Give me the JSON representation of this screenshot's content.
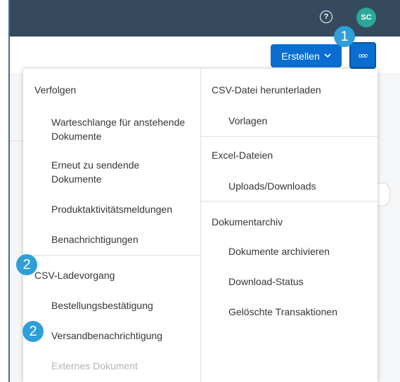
{
  "shell": {
    "help_label": "?",
    "avatar_initials": "SC"
  },
  "toolbar": {
    "create_label": "Erstellen",
    "more_label": "ooo"
  },
  "badges": [
    "1",
    "2",
    "2"
  ],
  "menu": {
    "left": {
      "verfolgen": "Verfolgen",
      "warteschlange": "Warteschlange für anstehende Dokumente",
      "erneut": "Erneut zu sendende Dokumente",
      "produktaktivitaet": "Produktaktivitätsmeldungen",
      "benachrichtigungen": "Benachrichtigungen",
      "csv_ladevorgang": "CSV-Ladevorgang",
      "bestellungsbestaetigung": "Bestellungsbestätigung",
      "versandbenachrichtigung": "Versandbenachrichtigung",
      "externes_dokument": "Externes Dokument"
    },
    "right": {
      "csv_download": "CSV-Datei herunterladen",
      "vorlagen": "Vorlagen",
      "excel": "Excel-Dateien",
      "uploads": "Uploads/Downloads",
      "archiv": "Dokumentarchiv",
      "archivieren": "Dokumente archivieren",
      "download_status": "Download-Status",
      "geloeschte": "Gelöschte Transaktionen"
    }
  }
}
